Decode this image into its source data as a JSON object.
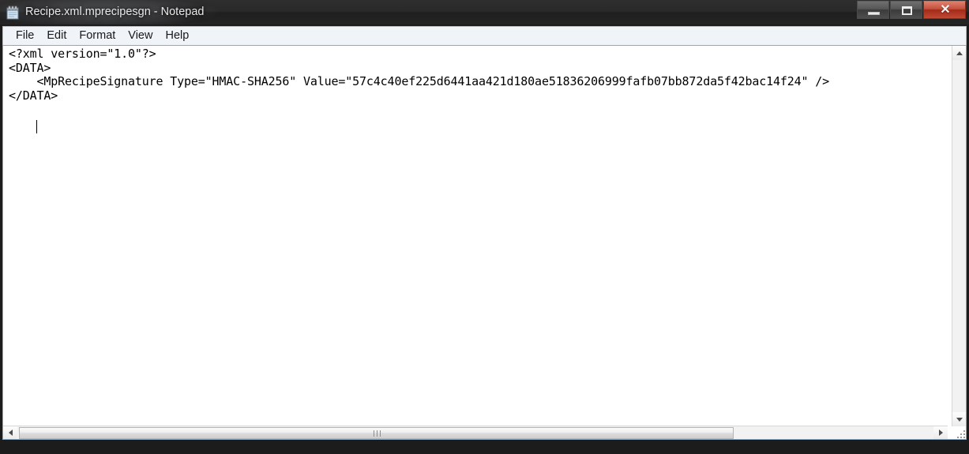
{
  "window": {
    "title": "Recipe.xml.mprecipesgn - Notepad",
    "icon": "notepad-icon",
    "controls": {
      "minimize_label": "–",
      "maximize_label": "□",
      "close_label": "✕"
    }
  },
  "menubar": {
    "items": [
      {
        "label": "File"
      },
      {
        "label": "Edit"
      },
      {
        "label": "Format"
      },
      {
        "label": "View"
      },
      {
        "label": "Help"
      }
    ]
  },
  "editor": {
    "content": "<?xml version=\"1.0\"?>\n<DATA>\n    <MpRecipeSignature Type=\"HMAC-SHA256\" Value=\"57c4c40ef225d6441aa421d180ae51836206999fafb07bb872da5f42bac14f24\" />\n</DATA>",
    "lines": [
      "<?xml version=\"1.0\"?>",
      "<DATA>",
      "    <MpRecipeSignature Type=\"HMAC-SHA256\" Value=\"57c4c40ef225d6441aa421d180ae51836206999fafb07bb872da5f42bac14f24\" />",
      "</DATA>"
    ],
    "signature": {
      "element": "MpRecipeSignature",
      "type": "HMAC-SHA256",
      "value": "57c4c40ef225d6441aa421d180ae51836206999fafb07bb872da5f42bac14f24"
    },
    "caret_line": 3,
    "caret_column": 5
  },
  "scrollbars": {
    "vertical": {
      "up_arrow": "▲",
      "down_arrow": "▼"
    },
    "horizontal": {
      "left_arrow": "◀",
      "right_arrow": "▶"
    }
  },
  "colors": {
    "titlebar": "#242424",
    "menubar": "#f0f4f8",
    "editor_bg": "#ffffff",
    "close_button": "#a32a17",
    "text": "#000000"
  }
}
